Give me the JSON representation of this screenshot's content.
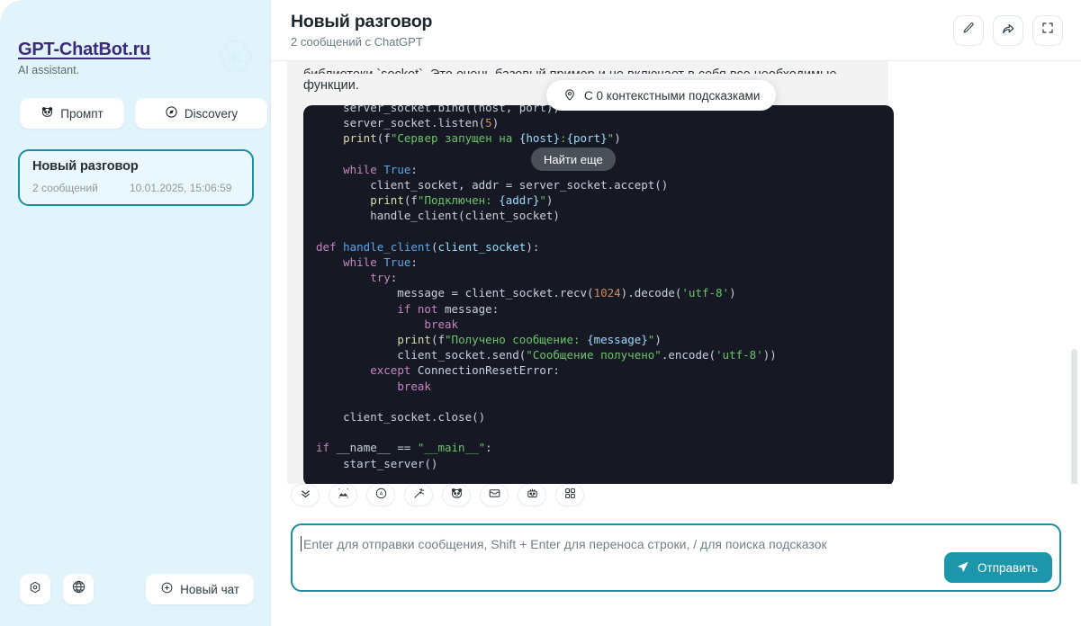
{
  "sidebar": {
    "brand_title": "GPT-ChatBot.ru",
    "brand_subtitle": "AI assistant.",
    "pills": [
      {
        "label": "Промпт",
        "icon": "panda-face-icon"
      },
      {
        "label": "Discovery",
        "icon": "compass-icon"
      }
    ],
    "conversation": {
      "title": "Новый разговор",
      "message_count": "2 сообщений",
      "timestamp": "10.01.2025, 15:06:59"
    },
    "bottom": {
      "settings_icon": "gear-hexagon-icon",
      "language_icon": "globe-icon",
      "new_chat_label": "Новый чат",
      "new_chat_icon": "plus-circle-icon"
    },
    "watermark_icon": "openai-logo-icon"
  },
  "header": {
    "title": "Новый разговор",
    "subtitle": "2 сообщений с ChatGPT",
    "actions": [
      {
        "name": "edit-button",
        "icon": "pencil-icon"
      },
      {
        "name": "share-button",
        "icon": "share-arrow-icon"
      },
      {
        "name": "fullscreen-button",
        "icon": "expand-icon"
      }
    ]
  },
  "chat": {
    "message_truncated_line": "библиотеки `socket`. Это очень базовый пример и не включает в себя все необходимые",
    "message_line": "функции.",
    "context_pill": {
      "label": "С 0 контекстными подсказками",
      "icon": "context-pin-icon"
    },
    "find_more_tooltip": "Найти еще",
    "code_language": "python",
    "code": "    server_socket.bind((host, port))\n    server_socket.listen(5)\n    print(f\"Сервер запущен на {host}:{port}\")\n\n    while True:\n        client_socket, addr = server_socket.accept()\n        print(f\"Подключен: {addr}\")\n        handle_client(client_socket)\n\ndef handle_client(client_socket):\n    while True:\n        try:\n            message = client_socket.recv(1024).decode('utf-8')\n            if not message:\n                break\n            print(f\"Получено сообщение: {message}\")\n            client_socket.send(\"Сообщение получено\".encode('utf-8'))\n        except ConnectionResetError:\n            break\n\n    client_socket.close()\n\nif __name__ == \"__main__\":\n    start_server()"
  },
  "composer": {
    "tools": [
      {
        "name": "scroll-down-button",
        "icon": "chevron-double-down-icon"
      },
      {
        "name": "image-button",
        "icon": "image-crop-icon"
      },
      {
        "name": "translate-button",
        "icon": "translate-circle-icon"
      },
      {
        "name": "magic-button",
        "icon": "magic-wand-icon"
      },
      {
        "name": "prompt-button",
        "icon": "panda-face-icon"
      },
      {
        "name": "inbox-button",
        "icon": "inbox-tray-icon"
      },
      {
        "name": "bot-button",
        "icon": "robot-icon"
      },
      {
        "name": "apps-button",
        "icon": "grid-apps-icon"
      }
    ],
    "input_placeholder": "Enter для отправки сообщения, Shift + Enter для переноса строки, / для поиска подсказок",
    "input_value": "",
    "send_label": "Отправить",
    "send_icon": "send-paper-plane-icon"
  },
  "colors": {
    "sidebar_bg": "#e2f4fb",
    "accent": "#1b8ea0",
    "send_button": "#1b96ab",
    "code_bg": "#161923",
    "brand": "#3b2b7a"
  }
}
